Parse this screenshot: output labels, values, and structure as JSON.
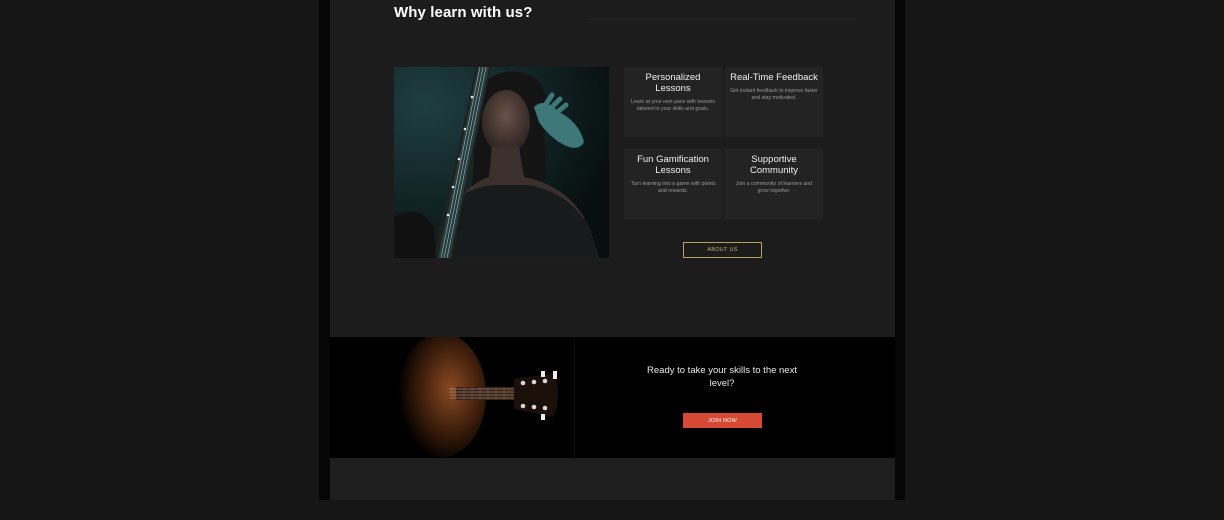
{
  "why_section": {
    "title": "Why learn with us?",
    "cards": [
      {
        "title": "Personalized Lessons",
        "text": "Learn at your own pace with lessons tailored to your skills and goals."
      },
      {
        "title": "Real-Time Feedback",
        "text": "Get instant feedback to improve faster and stay motivated."
      },
      {
        "title": "Fun Gamification Lessons",
        "text": "Turn learning into a game with points and rewards."
      },
      {
        "title": "Supportive Community",
        "text": "Join a community of learners and grow together."
      }
    ],
    "about_button": "ABOUT US"
  },
  "cta_section": {
    "heading": "Ready to take your skills to the next level?",
    "join_button": "JOIN NOW"
  },
  "colors": {
    "background": "#161616",
    "section_bg": "#1c1c1c",
    "card_bg": "#232323",
    "accent_gold": "#c9b26b",
    "cta_button": "#d64a35"
  }
}
